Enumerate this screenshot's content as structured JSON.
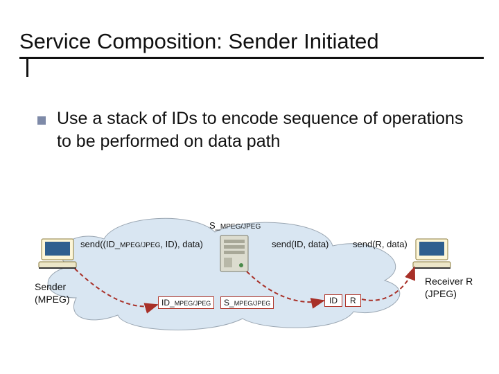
{
  "title": "Service Composition: Sender Initiated",
  "bullet": "Use a stack of IDs to encode sequence of operations to be performed on data path",
  "diagram": {
    "service_node": {
      "pre": "S_",
      "sub": "MPEG/JPEG"
    },
    "call1": {
      "pre": "send((ID_",
      "sub": "MPEG/JPEG",
      "post": ", ID), data)"
    },
    "call2": "send(ID, data)",
    "call3": "send(R, data)",
    "packet1": {
      "pre": "ID_",
      "sub": "MPEG/JPEG"
    },
    "packet2": {
      "pre": "S_",
      "sub": "MPEG/JPEG"
    },
    "packet3": "ID",
    "packet4": "R",
    "sender_label_l1": "Sender",
    "sender_label_l2": "(MPEG)",
    "receiver_label_l1": "Receiver R",
    "receiver_label_l2": "(JPEG)"
  }
}
